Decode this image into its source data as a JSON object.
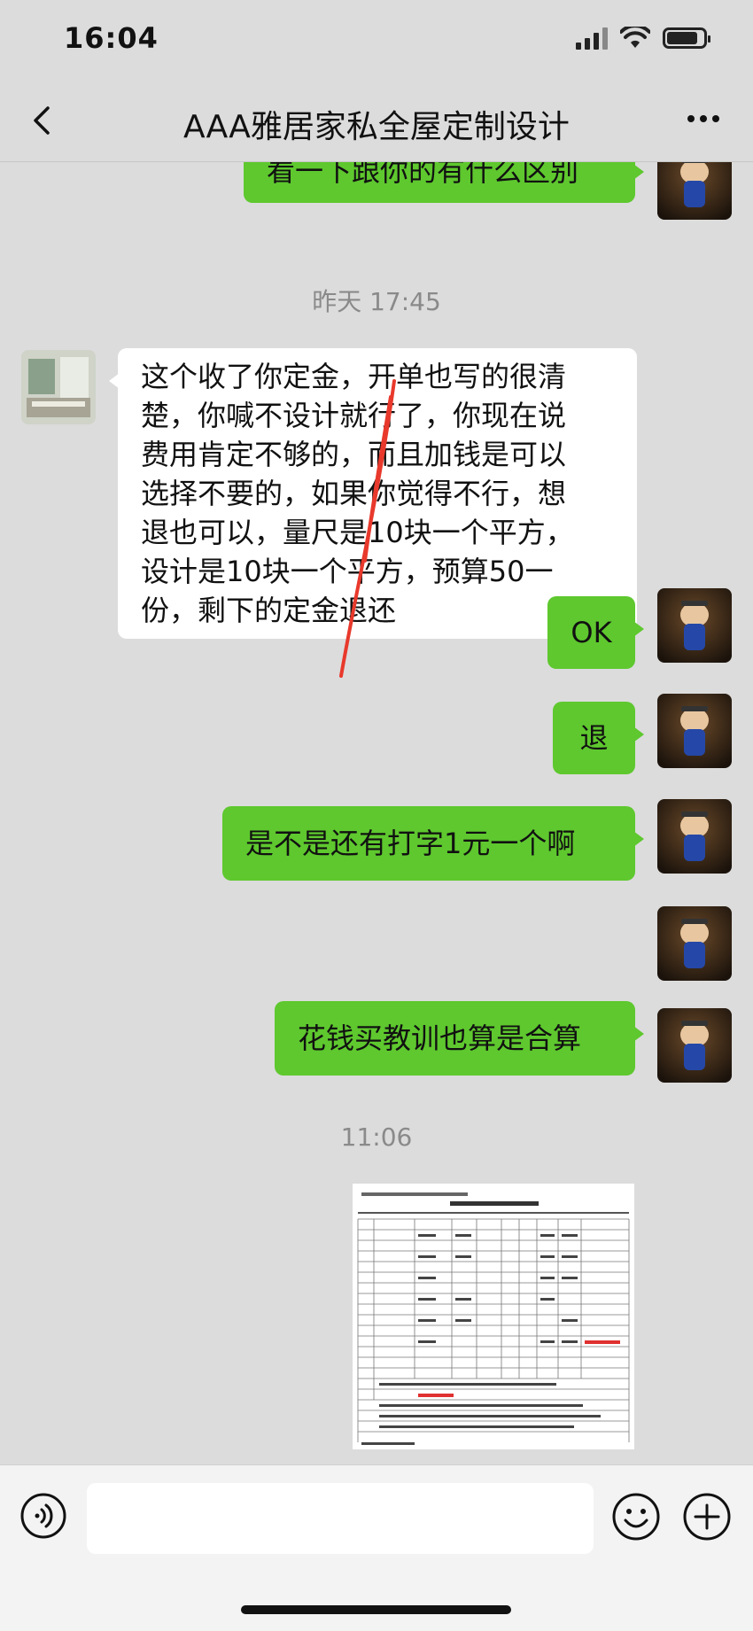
{
  "status_bar": {
    "time": "16:04",
    "battery_level": 0.85
  },
  "header": {
    "back_icon": "chevron-left-icon",
    "title": "AAA雅居家私全屋定制设计",
    "more_icon": "more-dots-icon"
  },
  "messages": [
    {
      "type": "text",
      "side": "out",
      "text": "看一下跟你的有什么区别"
    },
    {
      "type": "time",
      "text": "昨天 17:45"
    },
    {
      "type": "text",
      "side": "in",
      "lines": [
        "这个收了你定金，开单也写的很清",
        "楚，你喊不设计就行了，你现在说",
        "费用肯定不够的，而且加钱是可以",
        "选择不要的，如果你觉得不行，想",
        "退也可以，量尺是10块一个平方，",
        "设计是10块一个平方，预算50一",
        "份，剩下的定金退还"
      ]
    },
    {
      "type": "text",
      "side": "out",
      "text": "OK"
    },
    {
      "type": "text",
      "side": "out",
      "text": "退"
    },
    {
      "type": "text",
      "side": "out",
      "text": "是不是还有打字1元一个啊"
    },
    {
      "type": "text",
      "side": "out",
      "text": "花钱买教训也算是合算"
    },
    {
      "type": "time",
      "text": "11:06"
    },
    {
      "type": "image",
      "side": "out",
      "description": "定制家具报价单"
    }
  ],
  "input_bar": {
    "voice_icon": "voice-icon",
    "input_value": "",
    "emoji_icon": "emoji-icon",
    "plus_icon": "plus-icon"
  },
  "colors": {
    "background": "#dcdcdc",
    "outgoing_bubble": "#5ec82e",
    "incoming_bubble": "#ffffff",
    "timestamp": "#8a8a8a",
    "scribble": "#e8392c"
  }
}
